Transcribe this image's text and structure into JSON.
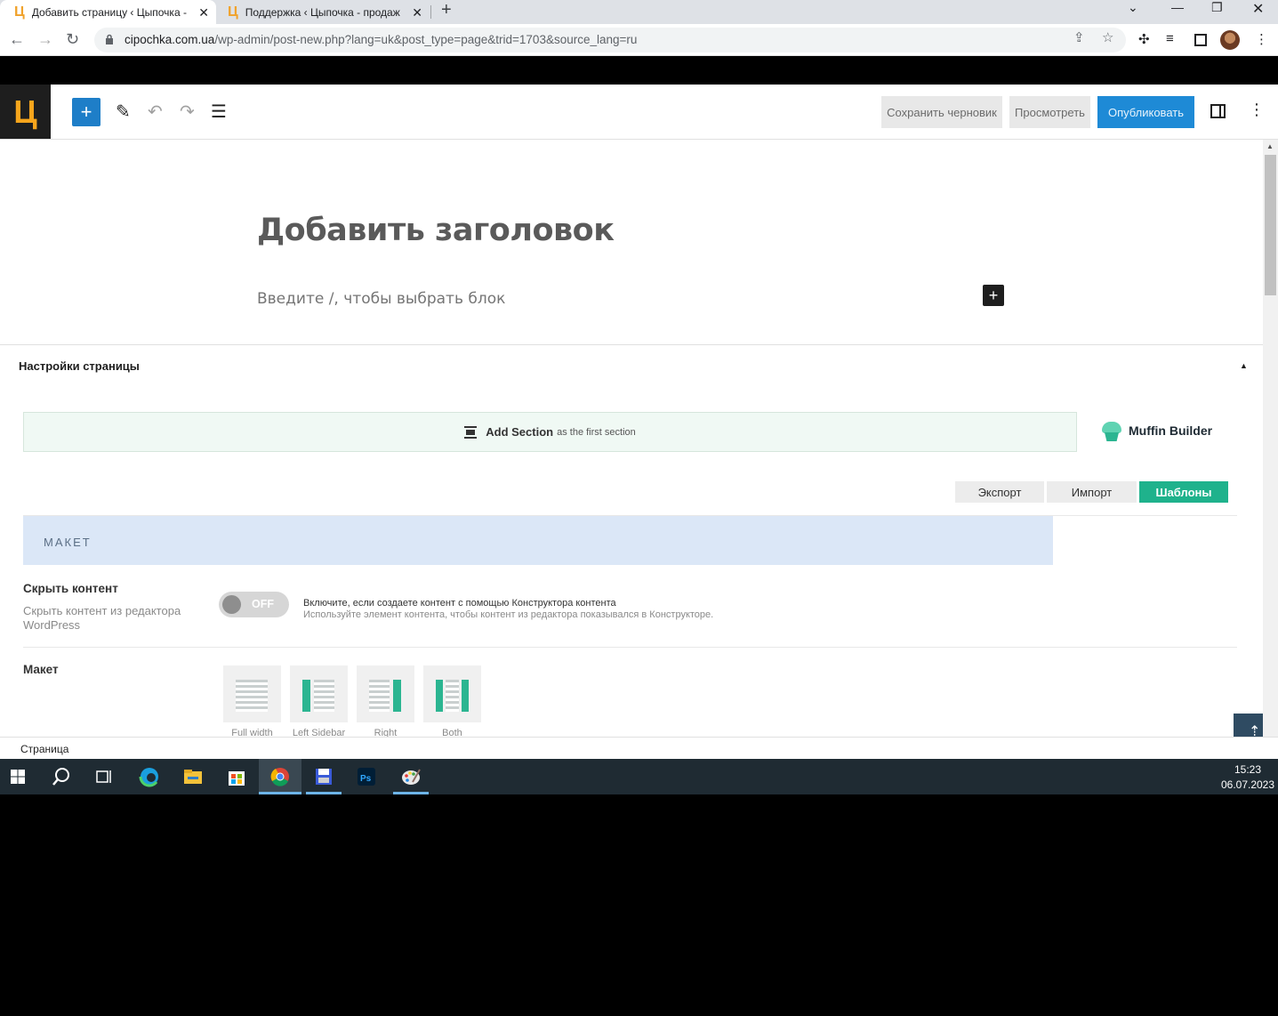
{
  "browser": {
    "tabs": [
      {
        "favicon": "Ц",
        "title": "Добавить страницу ‹ Цыпочка -",
        "active": true
      },
      {
        "favicon": "Ц",
        "title": "Поддержка ‹ Цыпочка - продаж",
        "active": false
      }
    ],
    "url_host": "cipochka.com.ua",
    "url_path": "/wp-admin/post-new.php?lang=uk&post_type=page&trid=1703&source_lang=ru"
  },
  "wp_toolbar": {
    "logo": "Ц",
    "save_draft": "Сохранить черновик",
    "preview": "Просмотреть",
    "publish": "Опубликовать"
  },
  "editor": {
    "title_placeholder": "Добавить заголовок",
    "block_placeholder": "Введите /, чтобы выбрать блок"
  },
  "page_settings": {
    "title": "Настройки страницы",
    "add_section": "Add Section",
    "add_section_sub": "as the first section",
    "builder_name": "Muffin Builder",
    "actions": {
      "export": "Экспорт",
      "import": "Импорт",
      "templates": "Шаблоны"
    },
    "section_head": "МАКЕТ",
    "hide_content": {
      "label": "Скрыть контент",
      "desc": "Скрыть контент из редактора WordPress",
      "toggle": "OFF",
      "hint1": "Включите, если создаете контент с помощью Конструктора контента",
      "hint2": "Используйте элемент контента, чтобы контент из редактора показывался в Конструкторе."
    },
    "layout": {
      "label": "Макет",
      "options": [
        "Full width",
        "Left Sidebar",
        "Right",
        "Both"
      ]
    }
  },
  "footer": {
    "breadcrumb": "Страница"
  },
  "taskbar": {
    "time": "15:23",
    "date": "06.07.2023"
  },
  "colors": {
    "accent": "#1fb28c",
    "publish": "#1e8ad6",
    "wp_dark": "#1e1e1e"
  }
}
